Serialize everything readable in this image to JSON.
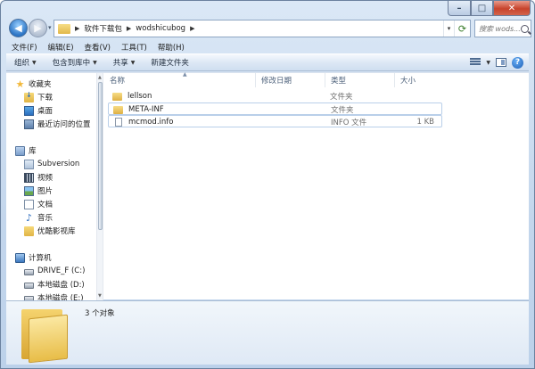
{
  "window": {
    "controls": {
      "minimize": "–",
      "maximize": "□",
      "close": "✕"
    }
  },
  "address": {
    "crumbs": [
      "软件下载包",
      "wodshicubog"
    ],
    "search_placeholder": "搜索 wods..."
  },
  "menu": [
    "文件(F)",
    "编辑(E)",
    "查看(V)",
    "工具(T)",
    "帮助(H)"
  ],
  "toolbar": {
    "organize": "组织",
    "include_library": "包含到库中",
    "share": "共享",
    "new_folder": "新建文件夹"
  },
  "navpane": {
    "favorites": {
      "label": "收藏夹",
      "items": [
        "下载",
        "桌面",
        "最近访问的位置"
      ]
    },
    "libraries": {
      "label": "库",
      "items": [
        "Subversion",
        "视频",
        "图片",
        "文档",
        "音乐",
        "优酷影视库"
      ]
    },
    "computer": {
      "label": "计算机",
      "items": [
        "DRIVE_F (C:)",
        "本地磁盘 (D:)",
        "本地磁盘 (E:)"
      ]
    }
  },
  "columns": {
    "name": "名称",
    "modified": "修改日期",
    "type": "类型",
    "size": "大小"
  },
  "files": [
    {
      "name": "lellson",
      "type": "文件夹",
      "size": "",
      "kind": "folder"
    },
    {
      "name": "META-INF",
      "type": "文件夹",
      "size": "",
      "kind": "folder"
    },
    {
      "name": "mcmod.info",
      "type": "INFO 文件",
      "size": "1 KB",
      "kind": "file"
    }
  ],
  "status": {
    "count": "3 个对象"
  },
  "colors": {
    "accent": "#2b74c4",
    "folder": "#e2b84a",
    "selection_border": "#b9cfe9"
  }
}
